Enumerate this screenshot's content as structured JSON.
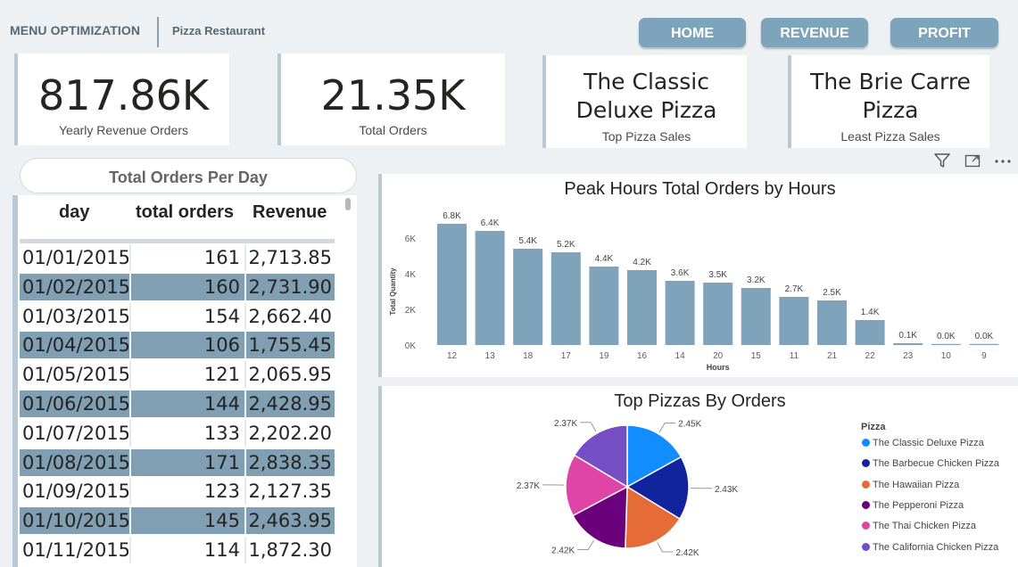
{
  "header": {
    "brand": "MENU OPTIMIZATION",
    "subtitle": "Pizza Restaurant"
  },
  "nav": {
    "home": "HOME",
    "revenue": "REVENUE",
    "profit": "PROFIT"
  },
  "kpis": {
    "revenue": {
      "value": "817.86K",
      "label": "Yearly Revenue Orders"
    },
    "orders": {
      "value": "21.35K",
      "label": "Total Orders"
    },
    "top": {
      "line1": "The Classic",
      "line2": "Deluxe Pizza",
      "label": "Top Pizza Sales"
    },
    "least": {
      "line1": "The Brie Carre",
      "line2": "Pizza",
      "label": "Least Pizza Sales"
    }
  },
  "table": {
    "title": "Total Orders Per Day",
    "columns": [
      "day",
      "total orders",
      "Revenue"
    ],
    "rows": [
      [
        "01/01/2015",
        "161",
        "2,713.85"
      ],
      [
        "01/02/2015",
        "160",
        "2,731.90"
      ],
      [
        "01/03/2015",
        "154",
        "2,662.40"
      ],
      [
        "01/04/2015",
        "106",
        "1,755.45"
      ],
      [
        "01/05/2015",
        "121",
        "2,065.95"
      ],
      [
        "01/06/2015",
        "144",
        "2,428.95"
      ],
      [
        "01/07/2015",
        "133",
        "2,202.20"
      ],
      [
        "01/08/2015",
        "171",
        "2,838.35"
      ],
      [
        "01/09/2015",
        "123",
        "2,127.35"
      ],
      [
        "01/10/2015",
        "145",
        "2,463.95"
      ],
      [
        "01/11/2015",
        "114",
        "1,872.30"
      ]
    ]
  },
  "icons": {
    "filter": "filter-icon",
    "focus": "focus-mode-icon",
    "more": "more-options-icon"
  },
  "colors": {
    "bar": "#7fa3ba",
    "accent": "#809fb3",
    "nav": "#7ea4bb"
  },
  "chart_data": [
    {
      "type": "bar",
      "title": "Peak Hours Total Orders by Hours",
      "xlabel": "Hours",
      "ylabel": "Total Quantity",
      "categories": [
        "12",
        "13",
        "18",
        "17",
        "19",
        "16",
        "14",
        "20",
        "15",
        "11",
        "21",
        "22",
        "23",
        "10",
        "9"
      ],
      "values": [
        6800,
        6400,
        5400,
        5200,
        4400,
        4200,
        3600,
        3500,
        3200,
        2700,
        2500,
        1400,
        100,
        20,
        10
      ],
      "data_labels": [
        "6.8K",
        "6.4K",
        "5.4K",
        "5.2K",
        "4.4K",
        "4.2K",
        "3.6K",
        "3.5K",
        "3.2K",
        "2.7K",
        "2.5K",
        "1.4K",
        "0.1K",
        "0.0K",
        "0.0K"
      ],
      "yticks": [
        "0K",
        "2K",
        "4K",
        "6K"
      ],
      "ylim": [
        0,
        7000
      ],
      "grid": false
    },
    {
      "type": "pie",
      "title": "Top Pizzas By Orders",
      "legend_title": "Pizza",
      "legend_position": "right",
      "slices": [
        {
          "name": "The Classic Deluxe Pizza",
          "value": 2450,
          "label": "2.45K",
          "color": "#118dff"
        },
        {
          "name": "The Barbecue Chicken Pizza",
          "value": 2430,
          "label": "2.43K",
          "color": "#12239e"
        },
        {
          "name": "The Hawaiian Pizza",
          "value": 2420,
          "label": "2.42K",
          "color": "#e66c37"
        },
        {
          "name": "The Pepperoni Pizza",
          "value": 2420,
          "label": "2.42K",
          "color": "#6b007b"
        },
        {
          "name": "The Thai Chicken Pizza",
          "value": 2370,
          "label": "2.37K",
          "color": "#e044a7"
        },
        {
          "name": "The California Chicken Pizza",
          "value": 2370,
          "label": "2.37K",
          "color": "#744ec2"
        }
      ]
    }
  ]
}
